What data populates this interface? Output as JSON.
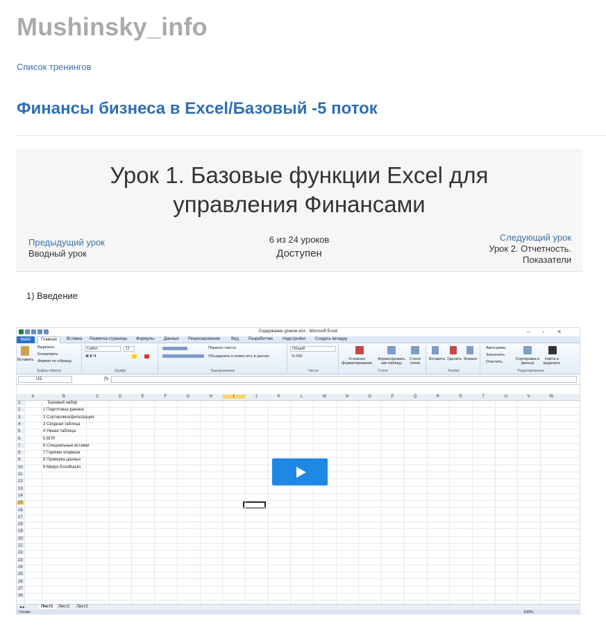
{
  "site": {
    "title": "Mushinsky_info"
  },
  "breadcrumb": {
    "label": "Список тренингов"
  },
  "course": {
    "title": "Финансы бизнеса в Excel/Базовый -5 поток"
  },
  "lesson": {
    "title_line1": "Урок 1. Базовые функции Excel для",
    "title_line2": "управления Финансами",
    "prev_label": "Предыдущий урок",
    "prev_name": "Вводный урок",
    "progress": "6 из 24 уроков",
    "status": "Доступен",
    "next_label": "Следующий урок",
    "next_name": "Урок 2. Отчетность. Показатели"
  },
  "content": {
    "intro": "1) Введение"
  },
  "excel": {
    "window_title": "Содержание уроков.xlsx - Microsoft Excel",
    "tabs": [
      "Файл",
      "Главная",
      "Вставка",
      "Разметка страницы",
      "Формулы",
      "Данные",
      "Рецензирование",
      "Вид",
      "Разработчик",
      "Надстройки",
      "Создать вкладку"
    ],
    "ribbon": {
      "paste": "Вставить",
      "cut": "Вырезать",
      "copy": "Копировать",
      "format_painter": "Формат по образцу",
      "clipboard": "Буфер обмена",
      "font_name": "Calibri",
      "font_size": "11",
      "font": "Шрифт",
      "wrap_text": "Перенос текста",
      "merge": "Объединить и поместить в центре",
      "alignment": "Выравнивание",
      "number_format": "Общий",
      "number": "Число",
      "cond_format": "Условное форматирование",
      "format_table": "Форматировать как таблицу",
      "cell_styles": "Стили ячеек",
      "styles": "Стили",
      "insert": "Вставить",
      "delete": "Удалить",
      "format": "Формат",
      "cells": "Ячейки",
      "autosum": "Автосумма",
      "fill": "Заполнить",
      "clear": "Очистить",
      "sort_filter": "Сортировка и фильтр",
      "find_select": "Найти и выделить",
      "editing": "Редактирование"
    },
    "name_box": "I15",
    "fx": "fx",
    "columns": [
      "A",
      "B",
      "C",
      "D",
      "E",
      "F",
      "G",
      "H",
      "I",
      "J",
      "K",
      "L",
      "M",
      "N",
      "O",
      "P",
      "Q",
      "R",
      "S",
      "T",
      "U",
      "V",
      "W"
    ],
    "header_cell": "Базовый набор",
    "items": [
      "1 Подготовка данных",
      "2 Сортировка/фильтрация",
      "3 Сводная таблица",
      "4 Умная таблица",
      "5 ВПР",
      "6 Специальные вставки",
      "7 Горячие клавиши",
      "8 Проверка данных",
      "9 Микро Excelhacks"
    ],
    "rows": [
      "1",
      "2",
      "3",
      "4",
      "5",
      "6",
      "7",
      "8",
      "9",
      "10",
      "11",
      "12",
      "13",
      "14",
      "15",
      "16",
      "17",
      "18",
      "19",
      "20",
      "21",
      "22",
      "23",
      "24",
      "25",
      "26",
      "27",
      "28"
    ],
    "sheets": [
      "Лист1",
      "Лист2",
      "Лист3"
    ],
    "status": "Готово",
    "zoom": "100%"
  },
  "colors": {
    "accent": "#2f6fb0",
    "play": "#1e88e5",
    "site_title": "#aaaaaa"
  }
}
